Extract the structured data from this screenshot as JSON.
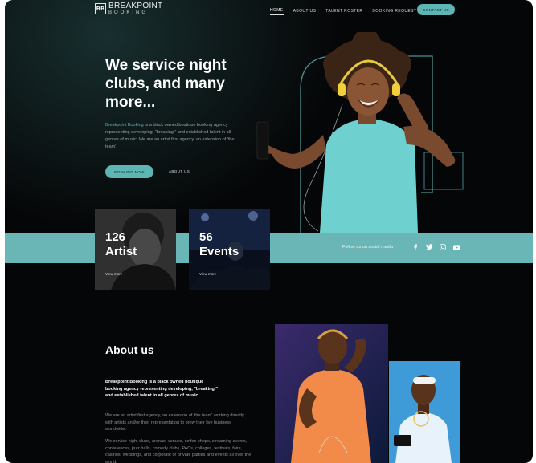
{
  "logo": {
    "mark": "BB",
    "line1": "BREAKPOINT",
    "line2": "BOOKING"
  },
  "nav": {
    "items": [
      "HOME",
      "ABOUT US",
      "TALENT ROSTER",
      "BOOKING REQUEST"
    ],
    "active_index": 0,
    "contact_label": "CONTACT US"
  },
  "hero": {
    "title": "We service night clubs, and many more...",
    "desc_highlight": "Breakpoint Booking",
    "desc_rest": " is a black owned boutique booking agency representing developing, \"breaking,\" and established talent in all genres of music. We are an artist first agency, an extension of 'the team'.",
    "booking_label": "BOOKING NOW",
    "about_label": "ABOUT US"
  },
  "stats": [
    {
      "number": "126",
      "label": "Artist",
      "link": "View more"
    },
    {
      "number": "56",
      "label": "Events",
      "link": "View more"
    }
  ],
  "social": {
    "label": "Follow us on social media",
    "icons": [
      "facebook-icon",
      "twitter-icon",
      "instagram-icon",
      "youtube-icon"
    ]
  },
  "about": {
    "title": "About us",
    "p1": "Breakpoint Booking is a black owned boutique booking agency representing developing, \"breaking,\" and established talent in all genres of music.",
    "p2": "We are an artist first agency, an extension of 'the team' working directly with artists and/or their representation to grow their live business worldwide.",
    "p3": "We service night clubs, arenas, venues, coffee shops, streaming events, conferences, jazz halls, comedy clubs, PACs, colleges, festivals, fairs, casinos, weddings, and corporate or private parties and events all over the world."
  },
  "colors": {
    "accent": "#5db5b4",
    "strip": "#6ab6b7",
    "background": "#050607"
  }
}
